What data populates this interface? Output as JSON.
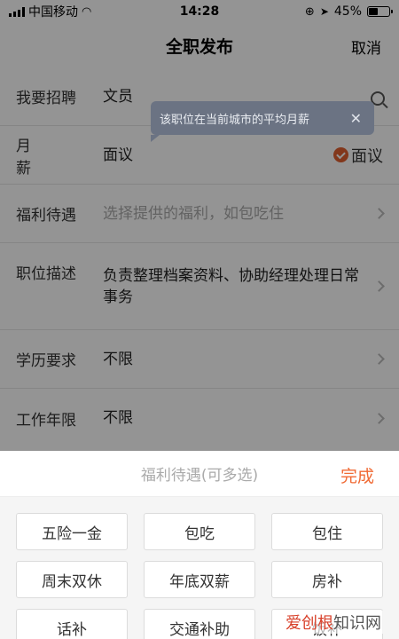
{
  "status_bar": {
    "carrier": "中国移动",
    "time": "14:28",
    "battery": "45%",
    "battery_level": 0.45
  },
  "nav": {
    "title": "全职发布",
    "cancel": "取消"
  },
  "form": {
    "rows": [
      {
        "label": "我要招聘",
        "value": "文员"
      },
      {
        "label": "月薪",
        "value": "面议",
        "negotiable": "面议"
      },
      {
        "label": "福利待遇",
        "placeholder": "选择提供的福利，如包吃住"
      },
      {
        "label": "职位描述",
        "value": "负责整理档案资料、协助经理处理日常事务"
      },
      {
        "label": "学历要求",
        "value": "不限"
      },
      {
        "label": "工作年限",
        "value": "不限"
      }
    ]
  },
  "tooltip": {
    "text": "该职位在当前城市的平均月薪",
    "close": "✕"
  },
  "sheet": {
    "title": "福利待遇(可多选)",
    "done": "完成",
    "options": [
      "五险一金",
      "包吃",
      "包住",
      "周末双休",
      "年底双薪",
      "房补",
      "话补",
      "交通补助",
      "饭补"
    ]
  },
  "watermark": {
    "red": "爱创根",
    "rest": "知识网"
  },
  "colors": {
    "accent": "#f06a34",
    "tooltip_bg": "#6b7383"
  }
}
